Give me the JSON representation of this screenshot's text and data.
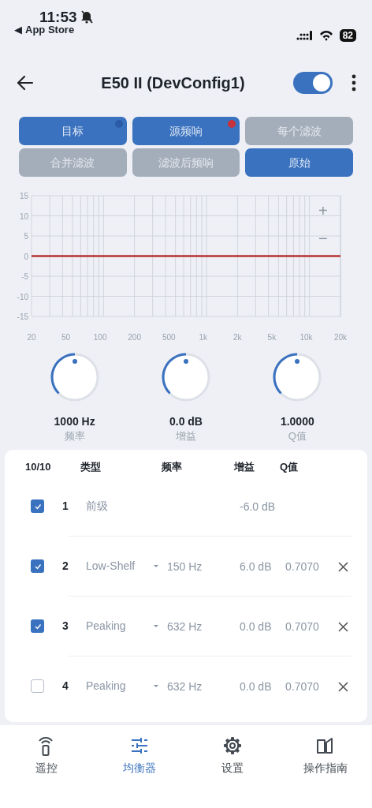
{
  "status_bar": {
    "time": "11:53",
    "back_arrow": "◀",
    "back_app": "App Store",
    "battery": "82"
  },
  "header": {
    "title": "E50 II (DevConfig1)",
    "toggle_on": true
  },
  "view_buttons": [
    {
      "label": "目标",
      "selected": true,
      "color": "#2b5aa8"
    },
    {
      "label": "源频响",
      "selected": true,
      "color": "#c8323a"
    },
    {
      "label": "每个滤波",
      "selected": false
    },
    {
      "label": "合并滤波",
      "selected": false
    },
    {
      "label": "滤波后频响",
      "selected": false
    },
    {
      "label": "原始",
      "selected": true
    }
  ],
  "chart": {
    "zoom_in": "+",
    "zoom_out": "−",
    "chart_data": {
      "type": "line",
      "categories": [
        "20",
        "50",
        "100",
        "200",
        "500",
        "1k",
        "2k",
        "5k",
        "10k",
        "20k"
      ],
      "series": [
        {
          "color": "#b83232",
          "values": [
            0,
            0,
            0,
            0,
            0,
            0,
            0,
            0,
            0,
            0
          ]
        }
      ],
      "ylim": [
        -15,
        15
      ],
      "grid": true,
      "yticks": [
        15,
        10,
        5,
        0,
        -5,
        -10,
        -15
      ]
    }
  },
  "knobs": [
    {
      "value": "1000 Hz",
      "label": "频率"
    },
    {
      "value": "0.0 dB",
      "label": "增益"
    },
    {
      "value": "1.0000",
      "label": "Q值"
    }
  ],
  "filters": {
    "count": "10/10",
    "columns": [
      "类型",
      "频率",
      "增益",
      "Q值"
    ],
    "rows": [
      {
        "kind": "preamp",
        "checked": true,
        "number": "1",
        "type": "前级",
        "gain": "-6.0 dB"
      },
      {
        "kind": "band",
        "checked": true,
        "number": "2",
        "type": "Low-Shelf",
        "frequency": "150 Hz",
        "gain": "6.0 dB",
        "q": "0.7070"
      },
      {
        "kind": "band",
        "checked": true,
        "number": "3",
        "type": "Peaking",
        "frequency": "632 Hz",
        "gain": "0.0 dB",
        "q": "0.7070"
      },
      {
        "kind": "band",
        "checked": false,
        "number": "4",
        "type": "Peaking",
        "frequency": "632 Hz",
        "gain": "0.0 dB",
        "q": "0.7070"
      }
    ]
  },
  "tab_bar": [
    {
      "kind": "remote",
      "label": "遥控",
      "selected": false
    },
    {
      "kind": "equalizer",
      "label": "均衡器",
      "selected": true
    },
    {
      "kind": "settings",
      "label": "设置",
      "selected": false
    },
    {
      "kind": "guide",
      "label": "操作指南",
      "selected": false
    }
  ]
}
